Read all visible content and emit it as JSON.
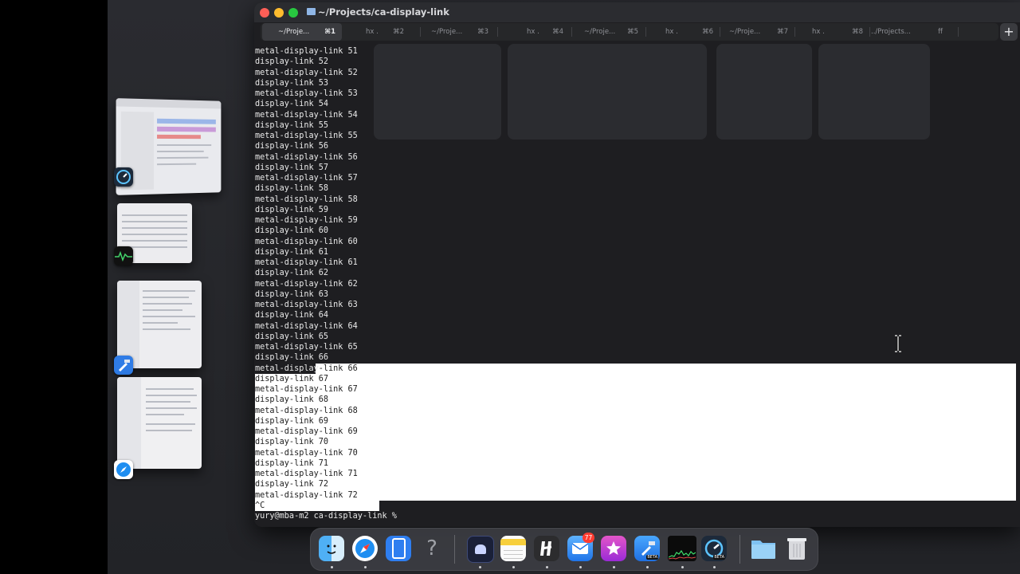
{
  "window": {
    "title": "~/Projects/ca-display-link",
    "new_tab": "+"
  },
  "tabs": [
    {
      "name": "~/Proje...",
      "key": "⌘1",
      "active": true
    },
    {
      "name": "hx .",
      "key": "⌘2"
    },
    {
      "name": "~/Proje...",
      "key": "⌘3"
    },
    {
      "name": "hx .",
      "key": "⌘4"
    },
    {
      "name": "~/Proje...",
      "key": "⌘5"
    },
    {
      "name": "hx .",
      "key": "⌘6"
    },
    {
      "name": "~/Proje...",
      "key": "⌘7"
    },
    {
      "name": "hx .",
      "key": "⌘8"
    },
    {
      "name": "../Projects...",
      "key": "ff"
    }
  ],
  "terminal": {
    "lines": [
      "metal-display-link 51",
      "display-link 52",
      "metal-display-link 52",
      "display-link 53",
      "metal-display-link 53",
      "display-link 54",
      "metal-display-link 54",
      "display-link 55",
      "metal-display-link 55",
      "display-link 56",
      "metal-display-link 56",
      "display-link 57",
      "metal-display-link 57",
      "display-link 58",
      "metal-display-link 58",
      "display-link 59",
      "metal-display-link 59",
      "display-link 60",
      "metal-display-link 60",
      "display-link 61",
      "metal-display-link 61",
      "display-link 62",
      "metal-display-link 62",
      "display-link 63",
      "metal-display-link 63",
      "display-link 64",
      "metal-display-link 64",
      "display-link 65",
      "metal-display-link 65",
      "display-link 66",
      "metal-display-link 66",
      "display-link 67",
      "metal-display-link 67",
      "display-link 68",
      "metal-display-link 68",
      "display-link 69",
      "metal-display-link 69",
      "display-link 70",
      "metal-display-link 70",
      "display-link 71",
      "metal-display-link 71",
      "display-link 72",
      "metal-display-link 72",
      "^C",
      "yury@mba-m2 ca-display-link % "
    ],
    "selection_start_line": 30,
    "selection_end_line": 43
  },
  "stage_manager": [
    {
      "app": "gauge-app-icon"
    },
    {
      "app": "activity-monitor-icon"
    },
    {
      "app": "xcode-beta-icon"
    },
    {
      "app": "safari-icon"
    }
  ],
  "dock": {
    "apps": [
      {
        "name": "finder-icon",
        "running": true
      },
      {
        "name": "safari-icon",
        "running": true
      },
      {
        "name": "blue-app-icon",
        "running": false
      },
      {
        "name": "help-icon",
        "running": false
      },
      {
        "name": "terminal-app-icon",
        "running": true
      },
      {
        "name": "notes-icon",
        "running": true
      },
      {
        "name": "helix-icon",
        "running": true
      },
      {
        "name": "mail-icon",
        "running": true
      },
      {
        "name": "star-app-icon",
        "running": true
      },
      {
        "name": "xcode-beta-icon",
        "running": true
      },
      {
        "name": "activity-graph-icon",
        "running": true
      },
      {
        "name": "gauge-app-icon",
        "running": true
      },
      {
        "name": "folder-icon",
        "running": false
      },
      {
        "name": "trash-icon",
        "running": false
      }
    ],
    "mail_badge": "77",
    "beta_label": "BETA"
  },
  "colors": {
    "close": "#fe5f57",
    "minimize": "#febc2e",
    "zoom": "#28c840",
    "selection": "#ffffff"
  }
}
